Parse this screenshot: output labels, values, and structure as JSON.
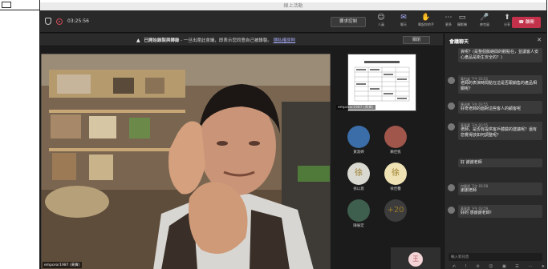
{
  "window": {
    "title": "線上活動"
  },
  "toolbar": {
    "timer": "03:25:56",
    "request_control": "要求控制",
    "icons": [
      {
        "glyph": "☺",
        "label": "人員",
        "name": "people-icon"
      },
      {
        "glyph": "✉",
        "label": "聊天",
        "name": "chat-icon",
        "active": true
      },
      {
        "glyph": "✋",
        "label": "舉起你的手",
        "name": "raise-hand-icon"
      },
      {
        "glyph": "⋯",
        "label": "更多",
        "name": "more-icon"
      }
    ],
    "right_icons": [
      {
        "glyph": "▭",
        "label": "攝影機",
        "name": "camera-icon"
      },
      {
        "glyph": "🎤",
        "label": "麥克風",
        "name": "mic-icon"
      },
      {
        "glyph": "⬆",
        "label": "分享",
        "name": "share-icon"
      }
    ],
    "leave": "離開"
  },
  "banner": {
    "warning": "▲",
    "text": "已開始錄製與轉錄",
    "subtext": "- 一旦出席此會議，即表示您同意自己被錄製。",
    "link": "隱私權原則",
    "dismiss": "關閉"
  },
  "stage": {
    "speaker_label": "emporor1987 (來賓)",
    "screen_label": "emporor1987 (來賓)"
  },
  "participants": [
    {
      "name": "黃淑婷",
      "initial": "",
      "color": "#3b6ea8"
    },
    {
      "name": "賴佳凱",
      "initial": "",
      "color": "#a0564a"
    },
    {
      "name": "徐以恩",
      "initial": "徐",
      "color": "#d9d9d2"
    },
    {
      "name": "徐佳馨",
      "initial": "徐",
      "color": "#efe3b5"
    },
    {
      "name": "陳展宏",
      "initial": "",
      "color": "#3e5e4e"
    },
    {
      "name": "",
      "initial": "+20",
      "color": "#3c3c3c"
    }
  ],
  "self": {
    "initial": "王"
  },
  "chat": {
    "title": "會議聊天",
    "close": "✕",
    "messages": [
      {
        "sender": "",
        "time": "",
        "text": "資呢？(是整個脈絡間的觀點在，並讓客人安心產品是衛生安全的？)"
      },
      {
        "sender": "黃怡姿",
        "time": "下午 03:55",
        "text": "老師的表演時間點在這是否跟銷售的產品相關呢？"
      },
      {
        "sender": "陳淑卿",
        "time": "下午 03:55",
        "text": "好奇老師的面對這些客人的顧客呢"
      },
      {
        "sender": "黃意嘉",
        "time": "下午 03:55",
        "text": "老師，是否有提供客戶體驗的建議呢？還有您覺得該如何調整呢？"
      },
      {
        "sender": "",
        "time": "",
        "text": "好 謝謝老師"
      },
      {
        "sender": "何健遠",
        "time": "下午 03:58",
        "text": "謝謝老師"
      },
      {
        "sender": "黃意嘉",
        "time": "下午 03:59",
        "text": "好的 感謝謝老師！"
      }
    ],
    "input_placeholder": "輸入新訊息",
    "tools": "✍ ! ⊘ ☺ ▣ ☰ ⋯ ➤"
  }
}
